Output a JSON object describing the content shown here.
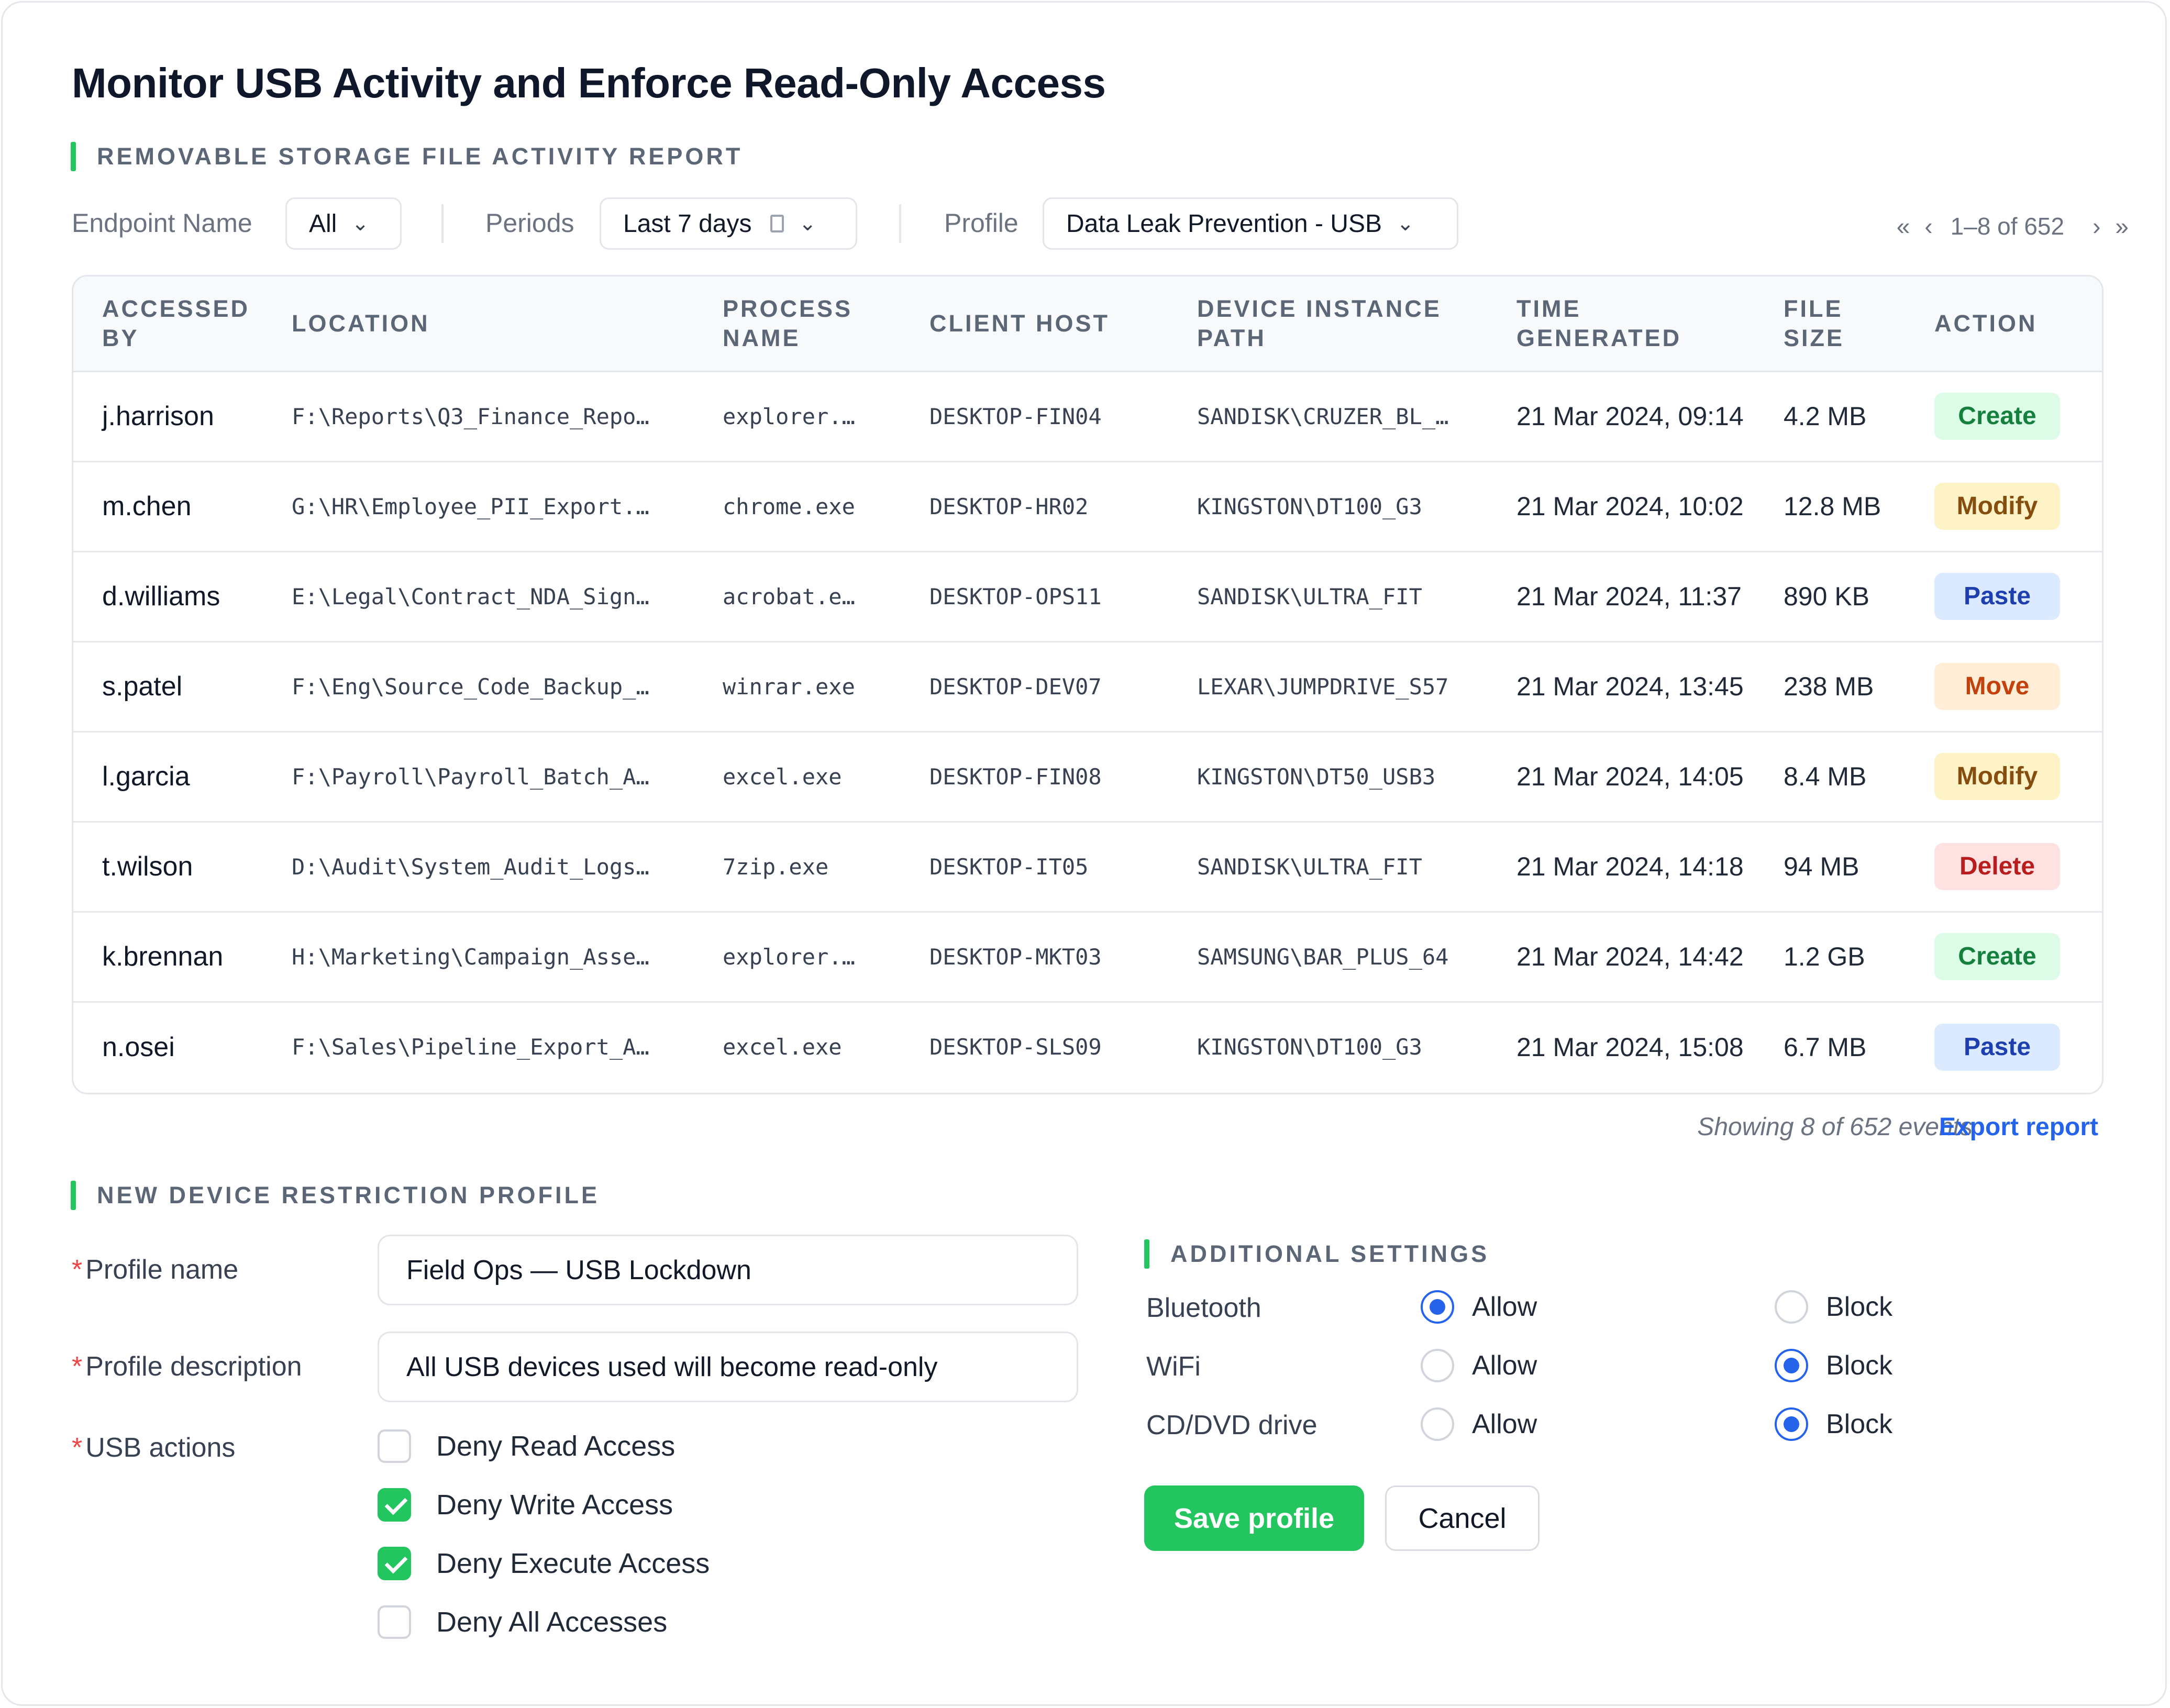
{
  "page": {
    "title": "Monitor USB Activity and Enforce Read-Only Access"
  },
  "report": {
    "section_title": "REMOVABLE STORAGE FILE ACTIVITY REPORT",
    "filters": {
      "endpoint": {
        "label": "Endpoint Name",
        "value": "All"
      },
      "periods": {
        "label": "Periods",
        "value": "Last 7 days"
      },
      "profile": {
        "label": "Profile",
        "value": "Data Leak Prevention - USB"
      }
    },
    "pagination": {
      "first": "«",
      "prev": "‹",
      "range": "1–8 of 652",
      "next": "›",
      "last": "»"
    },
    "columns": [
      "ACCESSED BY",
      "LOCATION",
      "PROCESS NAME",
      "CLIENT HOST",
      "DEVICE INSTANCE PATH",
      "TIME GENERATED",
      "FILE SIZE",
      "ACTION"
    ],
    "rows": [
      {
        "user": "j.harrison",
        "location": "F:\\Reports\\Q3_Finance_Repo…",
        "process": "explorer.…",
        "host": "DESKTOP-FIN04",
        "device": "SANDISK\\CRUZER_BL_…",
        "time": "21 Mar 2024, 09:14",
        "size": "4.2 MB",
        "action": "Create",
        "action_bg": "#dcfce7",
        "action_fg": "#15803d"
      },
      {
        "user": "m.chen",
        "location": "G:\\HR\\Employee_PII_Export.…",
        "process": "chrome.exe",
        "host": "DESKTOP-HR02",
        "device": "KINGSTON\\DT100_G3",
        "time": "21 Mar 2024, 10:02",
        "size": "12.8 MB",
        "action": "Modify",
        "action_bg": "#fef3c7",
        "action_fg": "#854d0e"
      },
      {
        "user": "d.williams",
        "location": "E:\\Legal\\Contract_NDA_Sign…",
        "process": "acrobat.e…",
        "host": "DESKTOP-OPS11",
        "device": "SANDISK\\ULTRA_FIT",
        "time": "21 Mar 2024, 11:37",
        "size": "890 KB",
        "action": "Paste",
        "action_bg": "#dbeafe",
        "action_fg": "#1e40af"
      },
      {
        "user": "s.patel",
        "location": "F:\\Eng\\Source_Code_Backup_…",
        "process": "winrar.exe",
        "host": "DESKTOP-DEV07",
        "device": "LEXAR\\JUMPDRIVE_S57",
        "time": "21 Mar 2024, 13:45",
        "size": "238 MB",
        "action": "Move",
        "action_bg": "#ffedd5",
        "action_fg": "#c2410c"
      },
      {
        "user": "l.garcia",
        "location": "F:\\Payroll\\Payroll_Batch_A…",
        "process": "excel.exe",
        "host": "DESKTOP-FIN08",
        "device": "KINGSTON\\DT50_USB3",
        "time": "21 Mar 2024, 14:05",
        "size": "8.4 MB",
        "action": "Modify",
        "action_bg": "#fef3c7",
        "action_fg": "#854d0e"
      },
      {
        "user": "t.wilson",
        "location": "D:\\Audit\\System_Audit_Logs…",
        "process": "7zip.exe",
        "host": "DESKTOP-IT05",
        "device": "SANDISK\\ULTRA_FIT",
        "time": "21 Mar 2024, 14:18",
        "size": "94 MB",
        "action": "Delete",
        "action_bg": "#fee2e2",
        "action_fg": "#b91c1c"
      },
      {
        "user": "k.brennan",
        "location": "H:\\Marketing\\Campaign_Asse…",
        "process": "explorer.…",
        "host": "DESKTOP-MKT03",
        "device": "SAMSUNG\\BAR_PLUS_64",
        "time": "21 Mar 2024, 14:42",
        "size": "1.2 GB",
        "action": "Create",
        "action_bg": "#dcfce7",
        "action_fg": "#15803d"
      },
      {
        "user": "n.osei",
        "location": "F:\\Sales\\Pipeline_Export_A…",
        "process": "excel.exe",
        "host": "DESKTOP-SLS09",
        "device": "KINGSTON\\DT100_G3",
        "time": "21 Mar 2024, 15:08",
        "size": "6.7 MB",
        "action": "Paste",
        "action_bg": "#dbeafe",
        "action_fg": "#1e40af"
      }
    ],
    "footer": {
      "showing": "Showing 8 of 652 events",
      "export": "Export report"
    }
  },
  "profile_form": {
    "section_title": "NEW DEVICE RESTRICTION PROFILE",
    "required_mark": "*",
    "name": {
      "label": "Profile name",
      "value": "Field Ops — USB Lockdown"
    },
    "description": {
      "label": "Profile description",
      "value": "All USB devices used will become read-only"
    },
    "usb_actions": {
      "label": "USB actions",
      "options": [
        {
          "label": "Deny Read Access",
          "checked": false
        },
        {
          "label": "Deny Write Access",
          "checked": true
        },
        {
          "label": "Deny Execute Access",
          "checked": true
        },
        {
          "label": "Deny All Accesses",
          "checked": false
        }
      ]
    }
  },
  "additional_settings": {
    "section_title": "ADDITIONAL SETTINGS",
    "allow_label": "Allow",
    "block_label": "Block",
    "items": [
      {
        "label": "Bluetooth",
        "value": "Allow"
      },
      {
        "label": "WiFi",
        "value": "Block"
      },
      {
        "label": "CD/DVD drive",
        "value": "Block"
      }
    ]
  },
  "actions": {
    "save": "Save profile",
    "cancel": "Cancel"
  },
  "colors": {
    "accent_green": "#22c55e",
    "link_blue": "#2563eb",
    "required_red": "#ef4444"
  }
}
